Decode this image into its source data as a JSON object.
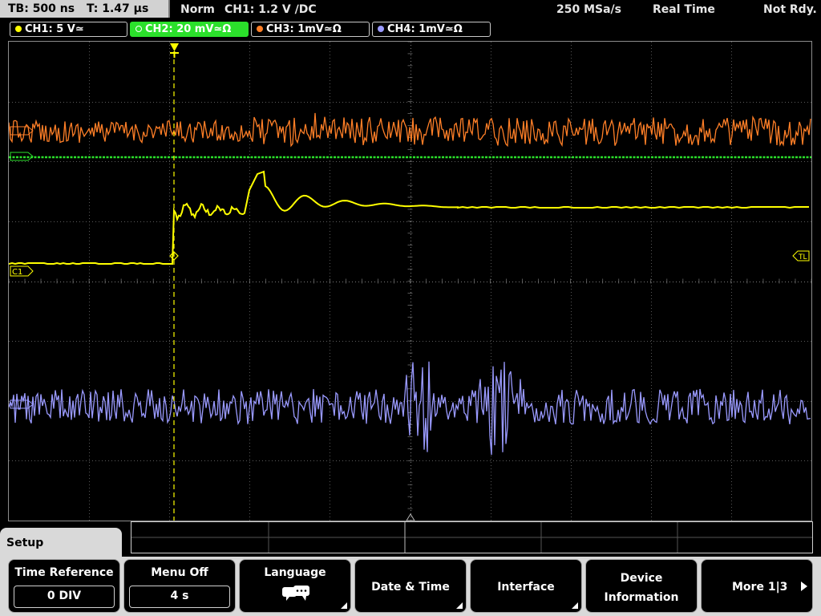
{
  "status": {
    "timebase": "TB: 500 ns",
    "trigger_time": "T: 1.47 µs",
    "mode": "Norm",
    "trigger_info": "CH1: 1.2 V ∕DC",
    "sample_rate": "250 MSa/s",
    "acq_mode": "Real Time",
    "state": "Not Rdy."
  },
  "channels": [
    {
      "label": "CH1: 5 V≃",
      "color": "#ffff00"
    },
    {
      "label": "CH2: 20 mV≃Ω",
      "color": "#2be02b"
    },
    {
      "label": "CH3: 1mV≃Ω",
      "color": "#ff7f27"
    },
    {
      "label": "CH4: 1mV≃Ω",
      "color": "#9a9aff"
    }
  ],
  "markers": {
    "c1": "C1",
    "tl": "TL"
  },
  "menu": {
    "tab": "Setup",
    "softkeys": [
      {
        "title": "Time Reference",
        "value": "0 DIV"
      },
      {
        "title": "Menu Off",
        "value": "4 s"
      },
      {
        "title": "Language",
        "icon": "speech-bubble-icon"
      },
      {
        "title": "Date & Time"
      },
      {
        "title": "Interface"
      },
      {
        "title": "Device",
        "title2": "Information"
      },
      {
        "title": "More 1|3"
      }
    ]
  },
  "colors": {
    "ch1": "#ffff00",
    "ch2": "#2be02b",
    "ch3": "#ff7f27",
    "ch4": "#9a9aff",
    "grid": "#7a7a7a"
  }
}
